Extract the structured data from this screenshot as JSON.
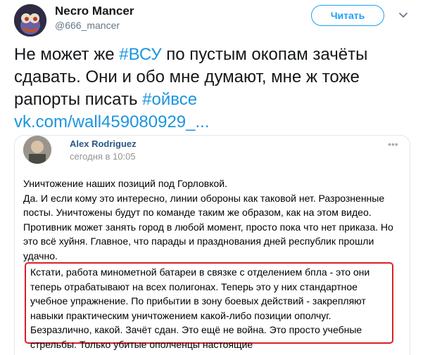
{
  "tweet": {
    "author_name": "Necro Mancer",
    "author_handle": "@666_mancer",
    "follow_label": "Читать",
    "text": {
      "line1_pre": "Не может же ",
      "hashtag1": "#ВСУ",
      "line1_post": " по пустым окопам зачёты сдавать. Они и обо мне думают, мне ж тоже рапорты писать ",
      "hashtag2": "#ойвсе",
      "link": "vk.com/wall459080929_..."
    }
  },
  "vk_post": {
    "author_name": "Alex Rodriguez",
    "date": "сегодня в 10:05",
    "more_icon": "more-dots-icon",
    "paragraph1": "Уничтожение наших позиций под Горловкой.\nДа. И если кому это интересно, линии обороны как таковой нет. Разрозненные посты. Уничтожены будут по команде таким же образом, как на этом видео. Противник может занять город в любой момент, просто пока что нет приказа. Но это всё хуйня. Главное, что парады и празднования дней республик прошли удачно.",
    "paragraph2": "Кстати, работа минометной батареи в связке с отделением бпла - это они теперь отрабатывают на всех полигонах. Теперь это у них стандартное учебное упражнение. По прибытии в зону боевых действий - закрепляют навыки практическим уничтожением какой-либо позиции ополчуг. Безразлично, какой. Зачёт сдан. Это ещё не война. Это просто учебные стрельбы. Только убитые ополченцы настоящие",
    "highlight_color": "#d92027"
  }
}
